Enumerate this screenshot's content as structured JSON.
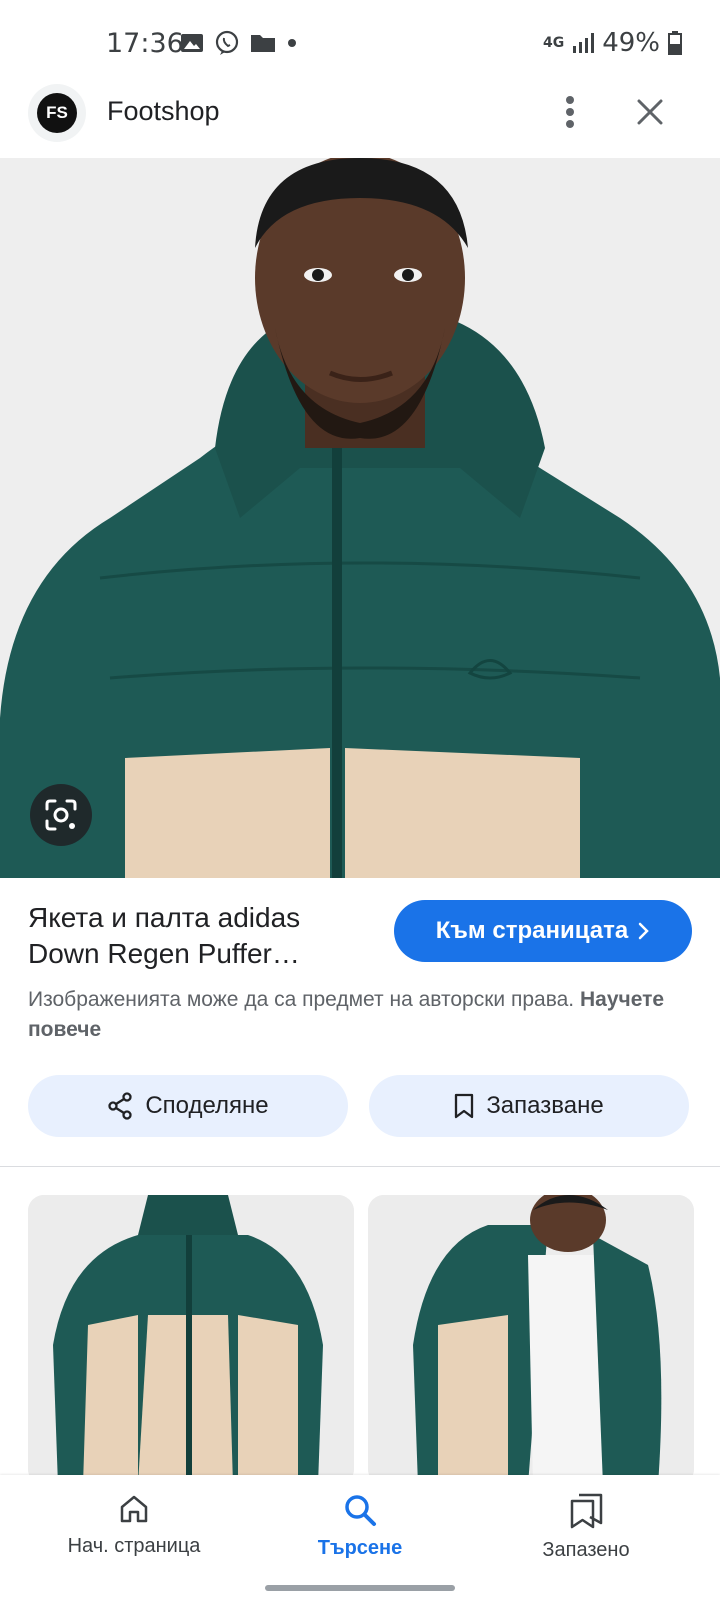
{
  "status_bar": {
    "time": "17:36",
    "network": "4G",
    "battery": "49%",
    "icons": [
      "image-icon",
      "viber-icon",
      "folder-icon",
      "dot-icon",
      "signal-icon",
      "battery-icon"
    ]
  },
  "header": {
    "logo_text": "FS",
    "site_name": "Footshop"
  },
  "product": {
    "title_line1": "Якета и палта adidas",
    "title_line2": "Down Regen Puffer…",
    "visit_label": "Към страницата"
  },
  "notice": {
    "text": "Изображенията може да са предмет на авторски права.",
    "link": "Научете повече"
  },
  "actions": {
    "share_label": "Споделяне",
    "save_label": "Запазване"
  },
  "bottom_nav": {
    "home_label": "Нач. страница",
    "search_label": "Търсене",
    "saved_label": "Запазено"
  },
  "colors": {
    "accent": "#1a73e8",
    "jacket_green": "#1e5a55",
    "jacket_beige": "#e8d2b8",
    "chip_bg": "#e8f0fe"
  }
}
